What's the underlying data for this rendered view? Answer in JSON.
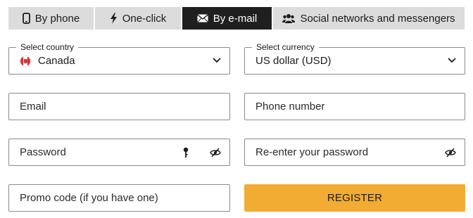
{
  "tabs": [
    {
      "label": "By phone",
      "icon": "phone-icon",
      "active": false
    },
    {
      "label": "One-click",
      "icon": "lightning-icon",
      "active": false
    },
    {
      "label": "By e-mail",
      "icon": "envelope-icon",
      "active": true
    },
    {
      "label": "Social networks and messengers",
      "icon": "users-icon",
      "active": false
    }
  ],
  "country": {
    "legend": "Select country",
    "value": "Canada",
    "flag_icon": "canada-flag-icon"
  },
  "currency": {
    "legend": "Select currency",
    "value": "US dollar (USD)"
  },
  "email": {
    "placeholder": "Email"
  },
  "phone": {
    "placeholder": "Phone number"
  },
  "password": {
    "placeholder": "Password"
  },
  "password_confirm": {
    "placeholder": "Re-enter your password"
  },
  "promo": {
    "placeholder": "Promo code (if you have one)"
  },
  "register": {
    "label": "REGISTER"
  },
  "colors": {
    "accent": "#f2ac34",
    "active_tab": "#1f1f1f",
    "tab": "#dcdcdc",
    "border": "#8a8a8a"
  }
}
